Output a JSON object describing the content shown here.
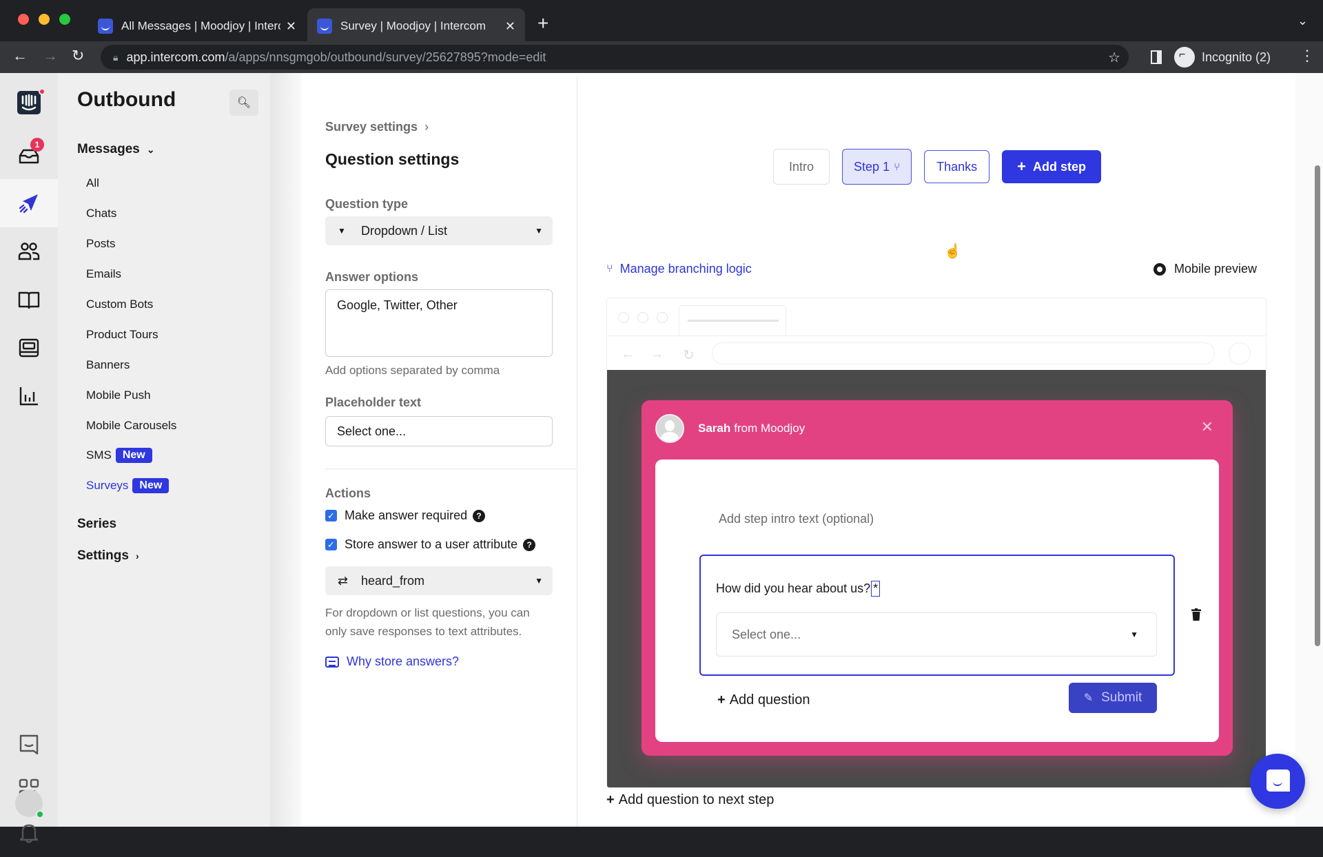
{
  "browser": {
    "tabs": [
      {
        "title": "All Messages | Moodjoy | Intercom",
        "active": false
      },
      {
        "title": "Survey | Moodjoy | Intercom",
        "active": true
      }
    ],
    "url_host": "app.intercom.com",
    "url_path": "/a/apps/nnsgmgob/outbound/survey/25627895?mode=edit",
    "profile_label": "Incognito (2)"
  },
  "rail": {
    "inbox_badge": "1",
    "icons": [
      "intercom-logo",
      "inbox-icon",
      "outbound-icon",
      "contacts-icon",
      "articles-icon",
      "reports-icon",
      "chart-icon",
      "messenger-icon",
      "apps-icon",
      "notifications-icon",
      "avatar"
    ]
  },
  "subnav": {
    "title": "Outbound",
    "messages_label": "Messages",
    "items": [
      {
        "label": "All"
      },
      {
        "label": "Chats"
      },
      {
        "label": "Posts"
      },
      {
        "label": "Emails"
      },
      {
        "label": "Custom Bots"
      },
      {
        "label": "Product Tours"
      },
      {
        "label": "Banners"
      },
      {
        "label": "Mobile Push"
      },
      {
        "label": "Mobile Carousels"
      },
      {
        "label": "SMS",
        "badge": "New"
      },
      {
        "label": "Surveys",
        "badge": "New",
        "active": true
      }
    ],
    "series_label": "Series",
    "settings_label": "Settings"
  },
  "settings": {
    "breadcrumb": "Survey settings",
    "title": "Question settings",
    "question_type_label": "Question type",
    "question_type_value": "Dropdown / List",
    "answer_options_label": "Answer options",
    "answer_options_value": "Google, Twitter, Other",
    "answer_options_hint": "Add options separated by comma",
    "placeholder_label": "Placeholder text",
    "placeholder_value": "Select one...",
    "actions_label": "Actions",
    "make_required_label": "Make answer required",
    "make_required_checked": true,
    "store_answer_label": "Store answer to a user attribute",
    "store_answer_checked": true,
    "attribute_value": "heard_from",
    "attribute_hint": "For dropdown or list questions, you can only save responses to text attributes.",
    "why_store_link": "Why store answers?"
  },
  "editor": {
    "steps": [
      {
        "label": "Intro"
      },
      {
        "label": "Step 1",
        "selected": true
      },
      {
        "label": "Thanks"
      }
    ],
    "add_step_label": "Add step",
    "branching_link": "Manage branching logic",
    "mobile_preview_label": "Mobile preview",
    "survey": {
      "sender_name": "Sarah",
      "sender_org": "from Moodjoy",
      "intro_placeholder": "Add step intro text (optional)",
      "question_text": "How did you hear about us?",
      "required_marker": "*",
      "select_placeholder": "Select one...",
      "add_question_label": "Add question",
      "submit_label": "Submit"
    },
    "add_next_step_label": "Add question to next step"
  },
  "colors": {
    "brand_blue": "#2e37e0",
    "survey_pink": "#e24282",
    "preview_bg": "#4a4a4a"
  }
}
